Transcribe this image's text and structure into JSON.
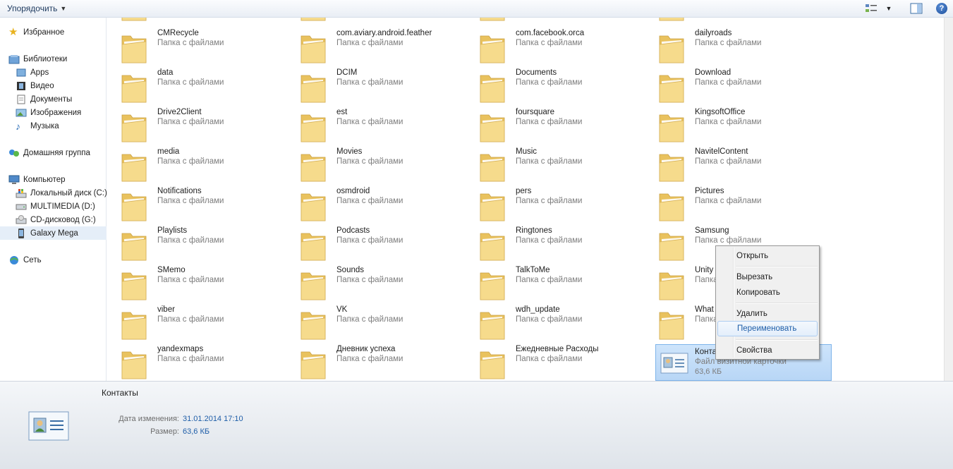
{
  "toolbar": {
    "organize_label": "Упорядочить",
    "help_label": "?"
  },
  "nav": {
    "favorites": "Избранное",
    "libraries": "Библиотеки",
    "lib_items": [
      "Apps",
      "Видео",
      "Документы",
      "Изображения",
      "Музыка"
    ],
    "homegroup": "Домашняя группа",
    "computer": "Компьютер",
    "drives": [
      "Локальный диск (C:)",
      "MULTIMEDIA (D:)",
      "CD-дисковод (G:)"
    ],
    "device": "Galaxy Mega",
    "network": "Сеть"
  },
  "folder_type": "Папка с файлами",
  "rows": [
    [
      "CMRecycle",
      "com.aviary.android.feather",
      "com.facebook.orca",
      "dailyroads"
    ],
    [
      "data",
      "DCIM",
      "Documents",
      "Download"
    ],
    [
      "Drive2Client",
      "est",
      "foursquare",
      "KingsoftOffice"
    ],
    [
      "media",
      "Movies",
      "Music",
      "NavitelContent"
    ],
    [
      "Notifications",
      "osmdroid",
      "pers",
      "Pictures"
    ],
    [
      "Playlists",
      "Podcasts",
      "Ringtones",
      "Samsung"
    ],
    [
      "SMemo",
      "Sounds",
      "TalkToMe",
      "Unity"
    ],
    [
      "viber",
      "VK",
      "wdh_update",
      "What"
    ],
    [
      "yandexmaps",
      "Дневник успеха",
      "Ежедневные Расходы",
      ""
    ]
  ],
  "selected_file": {
    "name": "Конта",
    "type": "Файл визитной карточки",
    "size": "63,6 КБ"
  },
  "context_menu": {
    "items": [
      "Открыть",
      "Вырезать",
      "Копировать",
      "Удалить",
      "Переименовать",
      "Свойства"
    ],
    "highlighted": "Переименовать"
  },
  "details": {
    "name": "Контакты",
    "modified_label": "Дата изменения:",
    "modified_value": "31.01.2014 17:10",
    "size_label": "Размер:",
    "size_value": "63,6 КБ"
  },
  "colors": {
    "folder": "#f4d67e",
    "selection": "#b8d6f6",
    "link": "#1f5ea8"
  }
}
